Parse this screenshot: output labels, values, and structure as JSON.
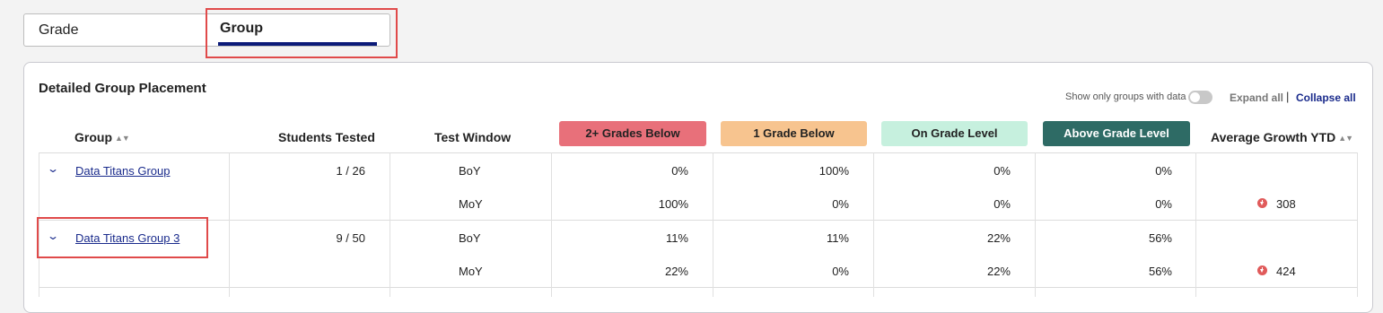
{
  "tabs": {
    "grade": "Grade",
    "group": "Group"
  },
  "card": {
    "title": "Detailed Group Placement",
    "toggle_label": "Show only groups with data",
    "expand_all": "Expand all",
    "separator": "|",
    "collapse_all": "Collapse all"
  },
  "columns": {
    "group": "Group",
    "students": "Students Tested",
    "window": "Test Window",
    "two_below": "2+ Grades Below",
    "one_below": "1 Grade Below",
    "on_level": "On Grade Level",
    "above": "Above Grade Level",
    "growth": "Average Growth YTD"
  },
  "colors": {
    "two_below": "#e8707a",
    "one_below": "#f7c48f",
    "on_level": "#c6f0de",
    "above": "#2e6b65",
    "link": "#1a2b8c",
    "highlight": "#e04a4a"
  },
  "rows": [
    {
      "name": "Data Titans Group",
      "students": "1 / 26",
      "windows": [
        {
          "window": "BoY",
          "two_below": "0%",
          "one_below": "100%",
          "on_level": "0%",
          "above": "0%",
          "growth": ""
        },
        {
          "window": "MoY",
          "two_below": "100%",
          "one_below": "0%",
          "on_level": "0%",
          "above": "0%",
          "growth": "308"
        }
      ]
    },
    {
      "name": "Data Titans Group 3",
      "students": "9 / 50",
      "windows": [
        {
          "window": "BoY",
          "two_below": "11%",
          "one_below": "11%",
          "on_level": "22%",
          "above": "56%",
          "growth": ""
        },
        {
          "window": "MoY",
          "two_below": "22%",
          "one_below": "0%",
          "on_level": "22%",
          "above": "56%",
          "growth": "424"
        }
      ]
    }
  ]
}
